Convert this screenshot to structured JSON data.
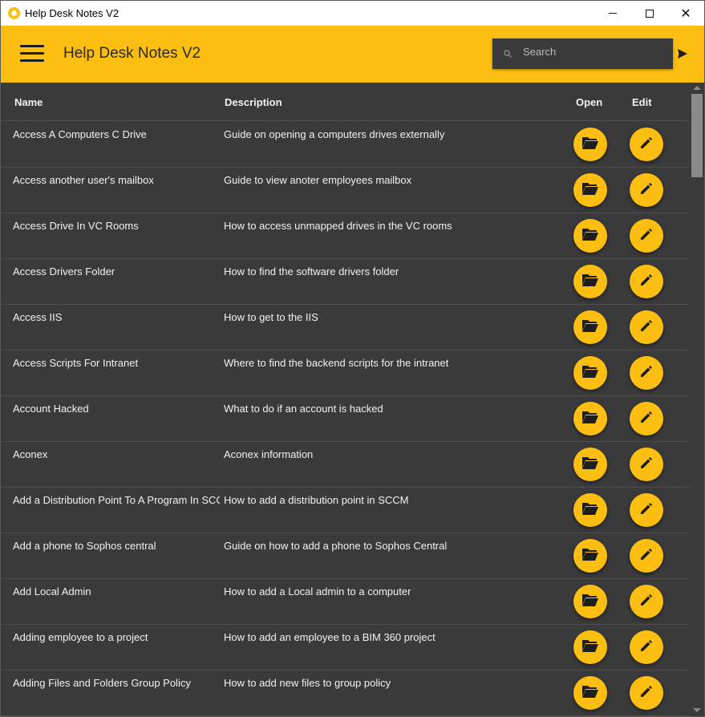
{
  "window": {
    "title": "Help Desk Notes V2",
    "icon": "app-logo-icon",
    "controls": [
      "minimize-icon",
      "maximize-icon",
      "close-icon"
    ],
    "close_glyph": "✕"
  },
  "appbar": {
    "title": "Help Desk Notes V2",
    "menu_icon": "hamburger-menu-icon",
    "search": {
      "placeholder": "Search",
      "value": "",
      "icon": "search-icon"
    },
    "send_icon": "send-icon",
    "accent": "#fcbf11"
  },
  "table": {
    "headers": {
      "name": "Name",
      "description": "Description",
      "open": "Open",
      "edit": "Edit"
    },
    "open_icon": "folder-open-icon",
    "edit_icon": "pencil-edit-icon",
    "rows": [
      {
        "name": "Access A Computers C Drive",
        "description": "Guide on opening a computers drives externally"
      },
      {
        "name": "Access another user's mailbox",
        "description": "Guide to view anoter employees mailbox"
      },
      {
        "name": "Access Drive In VC Rooms",
        "description": "How to access unmapped drives in the VC rooms"
      },
      {
        "name": "Access Drivers Folder",
        "description": "How to find the software drivers folder"
      },
      {
        "name": "Access IIS",
        "description": "How to get to the IIS"
      },
      {
        "name": "Access Scripts For Intranet",
        "description": "Where to find the backend scripts for the intranet"
      },
      {
        "name": "Account Hacked",
        "description": "What to do if an account is hacked"
      },
      {
        "name": "Aconex",
        "description": "Aconex information"
      },
      {
        "name": "Add a Distribution Point To A Program In SCCM",
        "description": "How to add a distribution point in SCCM"
      },
      {
        "name": "Add a phone to Sophos central",
        "description": "Guide on how to add a phone to Sophos Central"
      },
      {
        "name": "Add Local Admin",
        "description": "How to add a Local admin to a computer"
      },
      {
        "name": "Adding employee to a project",
        "description": "How to add an employee to a BIM 360 project"
      },
      {
        "name": "Adding Files and Folders Group Policy",
        "description": "How to add new files to group policy"
      }
    ]
  },
  "colors": {
    "background": "#3a3a3a",
    "text": "#f2f2f2",
    "accent": "#fcbf11"
  }
}
